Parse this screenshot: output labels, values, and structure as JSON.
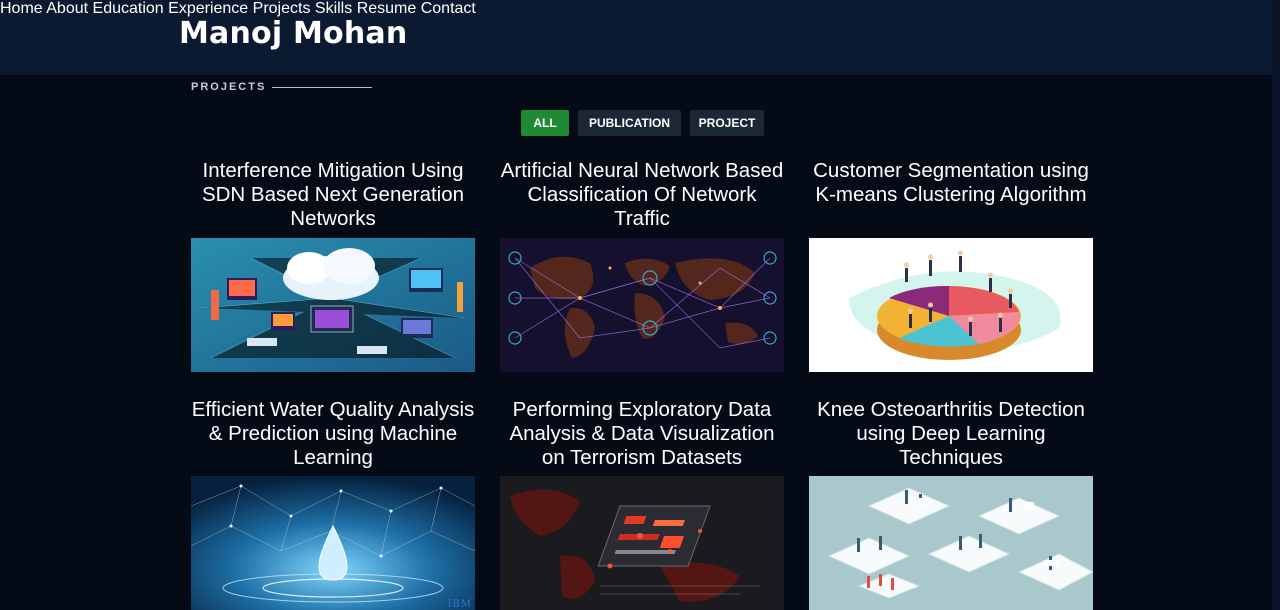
{
  "brand": "Manoj Mohan",
  "nav": [
    {
      "label": "Home",
      "active": false
    },
    {
      "label": "About",
      "active": false
    },
    {
      "label": "Education",
      "active": false
    },
    {
      "label": "Experience",
      "active": false
    },
    {
      "label": "Projects",
      "active": true
    },
    {
      "label": "Skills",
      "active": false
    },
    {
      "label": "Resume",
      "active": false
    },
    {
      "label": "Contact",
      "active": false
    }
  ],
  "section": {
    "title": "PROJECTS"
  },
  "filters": [
    {
      "label": "ALL",
      "active": true
    },
    {
      "label": "PUBLICATION",
      "active": false
    },
    {
      "label": "PROJECT",
      "active": false
    }
  ],
  "projects": [
    {
      "title": "Interference Mitigation Using SDN Based Next Generation Networks",
      "image": "cloud-network-illustration"
    },
    {
      "title": "Artificial Neural Network Based Classification Of Network Traffic",
      "image": "world-map-neural-network"
    },
    {
      "title": "Customer Segmentation using K-means Clustering Algorithm",
      "image": "pie-chart-people-illustration"
    },
    {
      "title": "Efficient Water Quality Analysis & Prediction using Machine Learning",
      "image": "water-drop-network",
      "watermark": "IBM"
    },
    {
      "title": "Performing Exploratory Data Analysis & Data Visualization on Terrorism Datasets",
      "image": "red-data-visualization"
    },
    {
      "title": "Knee Osteoarthritis Detection using Deep Learning Techniques",
      "image": "isometric-hospital-illustration"
    }
  ],
  "colors": {
    "background": "#040b17",
    "navbar": "#0c1a31",
    "accent": "#1ec24a",
    "filter_active": "#1e8b34",
    "filter_inactive": "#1c2735"
  }
}
